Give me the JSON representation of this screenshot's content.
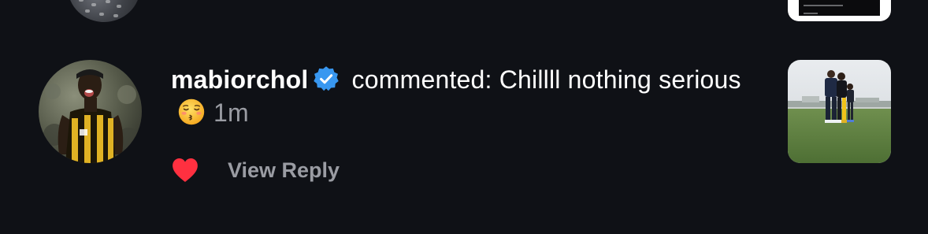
{
  "notification": {
    "username": "mabiorchol",
    "verified": true,
    "action_text": " commented: Chillll nothing serious",
    "emoji": "kissing-face-with-closed-eyes",
    "time": "1m",
    "view_reply_label": "View Reply",
    "liked": true
  },
  "colors": {
    "background": "#0f1116",
    "text": "#ffffff",
    "muted": "#9a9ca3",
    "verified_badge": "#3897f0",
    "heart": "#ff3040"
  },
  "icons": {
    "verified": "verified-badge-icon",
    "like": "heart-icon",
    "emoji": "kissing-face-icon"
  }
}
